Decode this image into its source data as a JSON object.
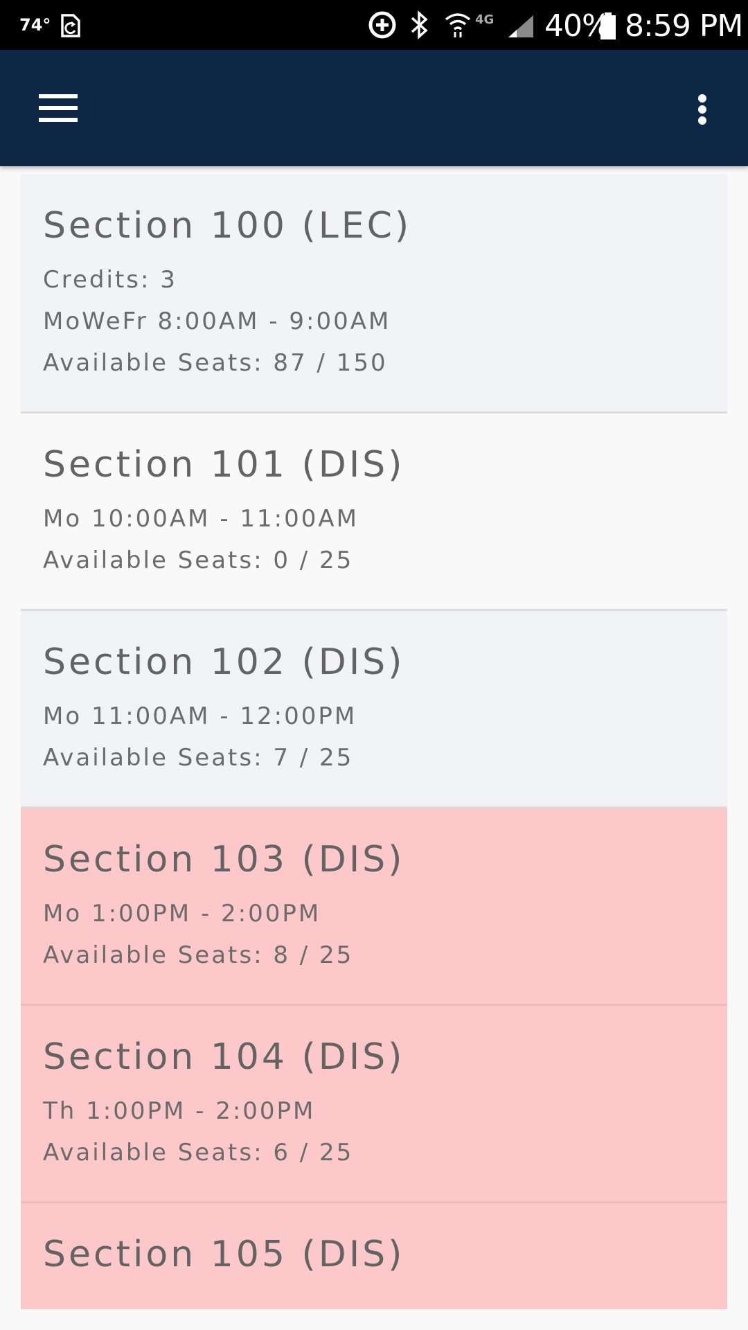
{
  "status_bar": {
    "temperature": "74°",
    "battery_percent": "40%",
    "time": "8:59 PM",
    "network": "4G"
  },
  "app_bar": {
    "background": "#0f2746",
    "menu_icon": "hamburger-menu-icon",
    "overflow_icon": "more-vert-icon"
  },
  "sections": [
    {
      "title": "Section 100 (LEC)",
      "state": "normal",
      "lines": [
        "Credits: 3",
        "MoWeFr 8:00AM - 9:00AM",
        "Available Seats: 87 / 150"
      ]
    },
    {
      "title": "Section 101 (DIS)",
      "state": "alt",
      "lines": [
        "Mo 10:00AM - 11:00AM",
        "Available Seats: 0 / 25"
      ]
    },
    {
      "title": "Section 102 (DIS)",
      "state": "normal",
      "lines": [
        "Mo 11:00AM - 12:00PM",
        "Available Seats: 7 / 25"
      ]
    },
    {
      "title": "Section 103 (DIS)",
      "state": "warn",
      "lines": [
        "Mo 1:00PM - 2:00PM",
        "Available Seats: 8 / 25"
      ]
    },
    {
      "title": "Section 104 (DIS)",
      "state": "warn",
      "lines": [
        "Th 1:00PM - 2:00PM",
        "Available Seats: 6 / 25"
      ]
    },
    {
      "title": "Section 105 (DIS)",
      "state": "warn",
      "lines": []
    }
  ],
  "colors": {
    "card_normal": "#f2f3f7",
    "card_alt": "#f9f9fa",
    "card_warn": "#fdc8ca",
    "text": "#636363"
  }
}
